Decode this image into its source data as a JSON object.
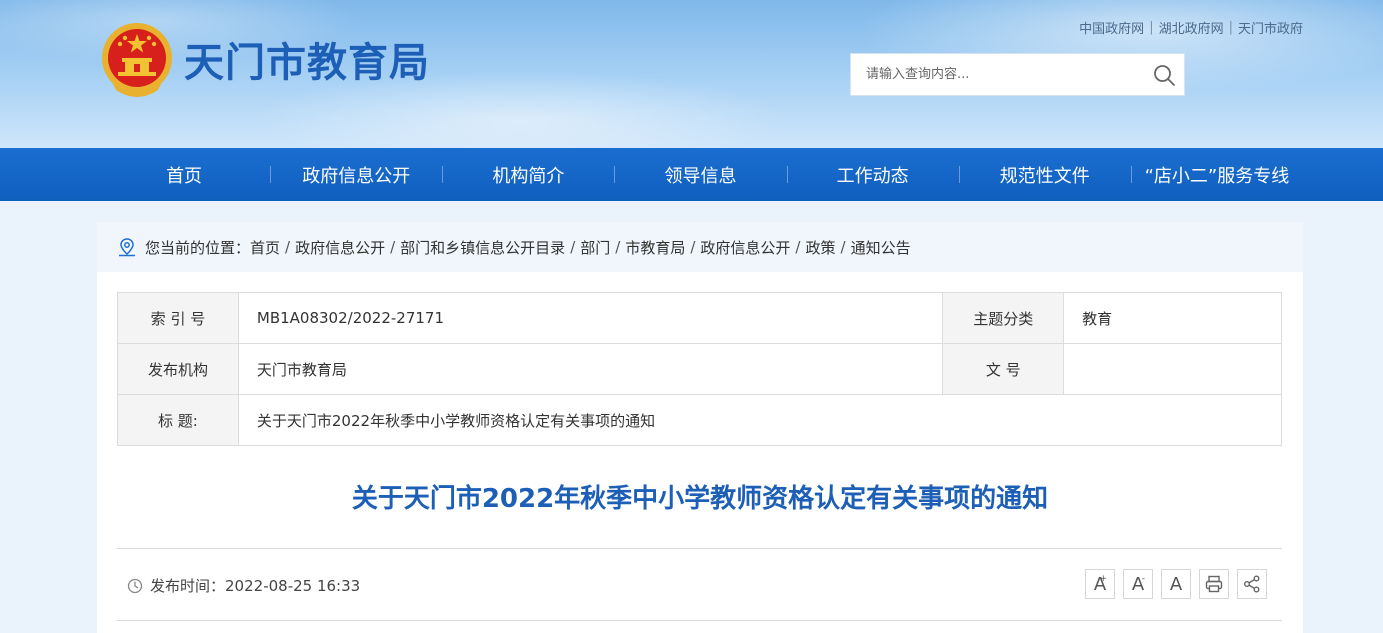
{
  "header": {
    "site_title": "天门市教育局",
    "top_links": [
      "中国政府网",
      "湖北政府网",
      "天门市政府"
    ],
    "search_placeholder": "请输入查询内容..."
  },
  "nav": {
    "items": [
      "首页",
      "政府信息公开",
      "机构简介",
      "领导信息",
      "工作动态",
      "规范性文件",
      "“店小二”服务专线"
    ]
  },
  "breadcrumb": {
    "prefix": "您当前的位置：",
    "items": [
      "首页",
      "政府信息公开",
      "部门和乡镇信息公开目录",
      "部门",
      "市教育局",
      "政府信息公开",
      "政策",
      "通知公告"
    ]
  },
  "meta": {
    "index_label": "索 引 号",
    "index_value": "MB1A08302/2022-27171",
    "topic_label": "主题分类",
    "topic_value": "教育",
    "org_label": "发布机构",
    "org_value": "天门市教育局",
    "docno_label": "文 号",
    "docno_value": "",
    "title_label": "标 题:",
    "title_value": "关于天门市2022年秋季中小学教师资格认定有关事项的通知"
  },
  "article": {
    "title": "关于天门市2022年秋季中小学教师资格认定有关事项的通知",
    "publish_label": "发布时间：",
    "publish_time": "2022-08-25 16:33"
  },
  "tools": {
    "font_large": "A",
    "font_small": "A",
    "font_default": "A",
    "plus": "+",
    "minus": "-"
  },
  "colors": {
    "brand_blue": "#1d5fb6",
    "nav_blue": "#1466c8",
    "emblem_red": "#d7201b",
    "emblem_gold": "#f3c232"
  }
}
